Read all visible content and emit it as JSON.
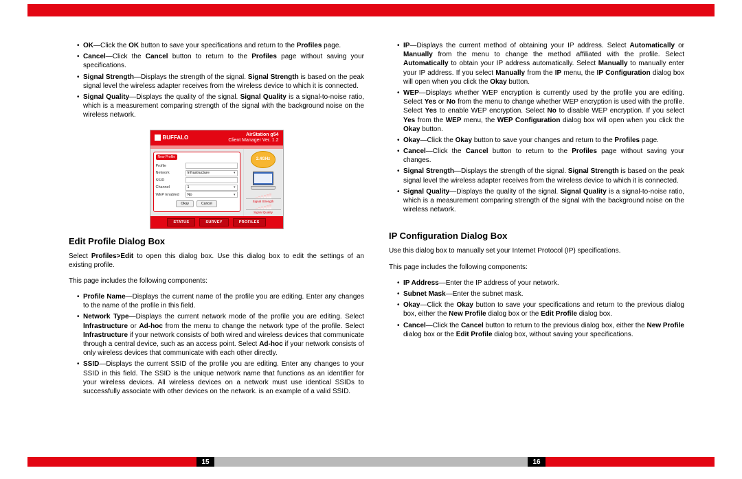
{
  "left": {
    "list1": {
      "item0": {
        "seg0b": "OK",
        "seg1": "—Click the ",
        "seg2b": "OK",
        "seg3": " button to save your specifications and return to the ",
        "seg4b": "Profiles",
        "seg5": " page."
      },
      "item1": {
        "seg0b": "Cancel",
        "seg1": "—Click the ",
        "seg2b": "Cancel",
        "seg3": " button to return to the ",
        "seg4b": "Profiles",
        "seg5": " page without saving your specifications."
      },
      "item2": {
        "seg0b": "Signal Strength",
        "seg1": "—Displays the strength of the signal. ",
        "seg2b": "Signal Strength",
        "seg3": " is based on the peak signal level the wireless adapter receives from the wireless device to which it is connected."
      },
      "item3": {
        "seg0b": "Signal Quality",
        "seg1": "—Displays the quality of the signal. ",
        "seg2b": "Signal Quality",
        "seg3": " is a signal-to-noise ratio, which is a measurement comparing strength of the signal with the background noise on the wireless network."
      }
    },
    "shot": {
      "brand": "BUFFALO",
      "title1": "AirStation g54",
      "title2": "Client Manager Ver. 1.2",
      "badge": "2.4GHz",
      "box_hd": "New Profile",
      "f_profile": "Profile",
      "f_network": "Network",
      "v_network": "Infrastructure",
      "f_ssid": "SSID",
      "f_channel": "Channel",
      "v_channel": "1",
      "f_wep": "WEP Enabled",
      "v_wep": "No",
      "btn_ok": "Okay",
      "btn_cancel": "Cancel",
      "m1": "Signal Strength",
      "m2": "Signal Quality",
      "tab1": "STATUS",
      "tab2": "SURVEY",
      "tab3": "PROFILES"
    },
    "h1": "Edit Profile Dialog Box",
    "p1": {
      "a": "Select ",
      "b": "Profiles>Edit",
      "c": " to open this dialog box. Use this dialog box to edit the settings of an existing profile."
    },
    "p2": "This page includes the following components:",
    "list2": {
      "item0": {
        "seg0b": "Profile Name",
        "seg1": "—Displays the current name of the profile you are editing. Enter any changes to the name of the profile in this field."
      },
      "item1": {
        "seg0b": "Network Type",
        "seg1": "—Displays the current network mode of the profile you are editing. Select ",
        "seg2b": "Infrastructure",
        "seg3": " or ",
        "seg4b": "Ad-hoc",
        "seg5": " from the menu to change the network type of the profile. Select ",
        "seg6b": "Infrastructure",
        "seg7": " if your network consists of both wired and wireless devices that communicate through a central device, such as an access point. Select ",
        "seg8b": "Ad-hoc",
        "seg9": " if your network consists of only wireless devices that communicate with each other directly."
      },
      "item2": {
        "seg0b": "SSID",
        "seg1": "—Displays the current SSID of the profile you are editing. Enter any changes to your SSID in this field. The SSID is the unique network name that functions as an identifier for your wireless devices. All wireless devices on a network must use identical SSIDs to successfully associate with other devices on the network. is an example of a valid SSID."
      }
    }
  },
  "right": {
    "list1": {
      "item0": {
        "seg0b": "IP",
        "seg1": "—Displays the current method of obtaining your IP address. Select ",
        "seg2b": "Automatically",
        "seg3": " or ",
        "seg4b": "Manually",
        "seg5": " from the menu to change the method affiliated with the profile. Select ",
        "seg6b": "Automatically",
        "seg7": " to obtain your IP address automatically. Select ",
        "seg8b": "Manually",
        "seg9": " to manually enter your IP address. If you select ",
        "seg10b": "Manually",
        "seg11": " from the ",
        "seg12b": "IP",
        "seg13": " menu, the ",
        "seg14b": "IP Configuration",
        "seg15": " dialog box will open when you click the ",
        "seg16b": "Okay",
        "seg17": " button."
      },
      "item1": {
        "seg0b": "WEP",
        "seg1": "—Displays whether WEP encryption is currently used by the profile you are editing. Select ",
        "seg2b": "Yes",
        "seg3": " or ",
        "seg4b": "No",
        "seg5": " from the menu to change whether WEP encryption is used with the profile. Select ",
        "seg6b": "Yes",
        "seg7": " to enable WEP encryption. Select ",
        "seg8b": "No",
        "seg9": " to disable WEP encryption. If you select ",
        "seg10b": "Yes",
        "seg11": " from the ",
        "seg12b": "WEP",
        "seg13": " menu, the ",
        "seg14b": "WEP Configuration",
        "seg15": " dialog box will open when you click the ",
        "seg16b": "Okay",
        "seg17": " button."
      },
      "item2": {
        "seg0b": "Okay",
        "seg1": "—Click the ",
        "seg2b": "Okay",
        "seg3": " button to save your changes and return to the ",
        "seg4b": "Profiles",
        "seg5": " page."
      },
      "item3": {
        "seg0b": "Cancel",
        "seg1": "—Click the ",
        "seg2b": "Cancel",
        "seg3": " button to return to the ",
        "seg4b": "Profiles",
        "seg5": " page without saving your changes."
      },
      "item4": {
        "seg0b": "Signal Strength",
        "seg1": "—Displays the strength of the signal. ",
        "seg2b": "Signal Strength",
        "seg3": " is based on the peak signal level the wireless adapter receives from the wireless device to which it is connected."
      },
      "item5": {
        "seg0b": "Signal Quality",
        "seg1": "—Displays the quality of the signal. ",
        "seg2b": "Signal Quality",
        "seg3": " is a signal-to-noise ratio, which is a measurement comparing strength of the signal with the background noise on the wireless network."
      }
    },
    "h1": "IP Configuration Dialog Box",
    "p1": "Use this dialog box to manually set your Internet Protocol (IP) specifications.",
    "p2": "This page includes the following components:",
    "list2": {
      "item0": {
        "seg0b": "IP Address",
        "seg1": "—Enter the IP address of your network."
      },
      "item1": {
        "seg0b": "Subnet Mask",
        "seg1": "—Enter the subnet mask."
      },
      "item2": {
        "seg0b": "Okay",
        "seg1": "—Click the ",
        "seg2b": "Okay",
        "seg3": " button to save your specifications and return to the previous dialog box, either the ",
        "seg4b": "New Profile",
        "seg5": " dialog box or the ",
        "seg6b": "Edit Profile",
        "seg7": " dialog box."
      },
      "item3": {
        "seg0b": "Cancel",
        "seg1": "—Click the ",
        "seg2b": "Cancel",
        "seg3": " button to return to the previous dialog box, either the ",
        "seg4b": "New Profile",
        "seg5": " dialog box or the ",
        "seg6b": "Edit Profile",
        "seg7": " dialog box, without saving your specifications."
      }
    }
  },
  "footer": {
    "pg_left": "15",
    "pg_right": "16"
  }
}
